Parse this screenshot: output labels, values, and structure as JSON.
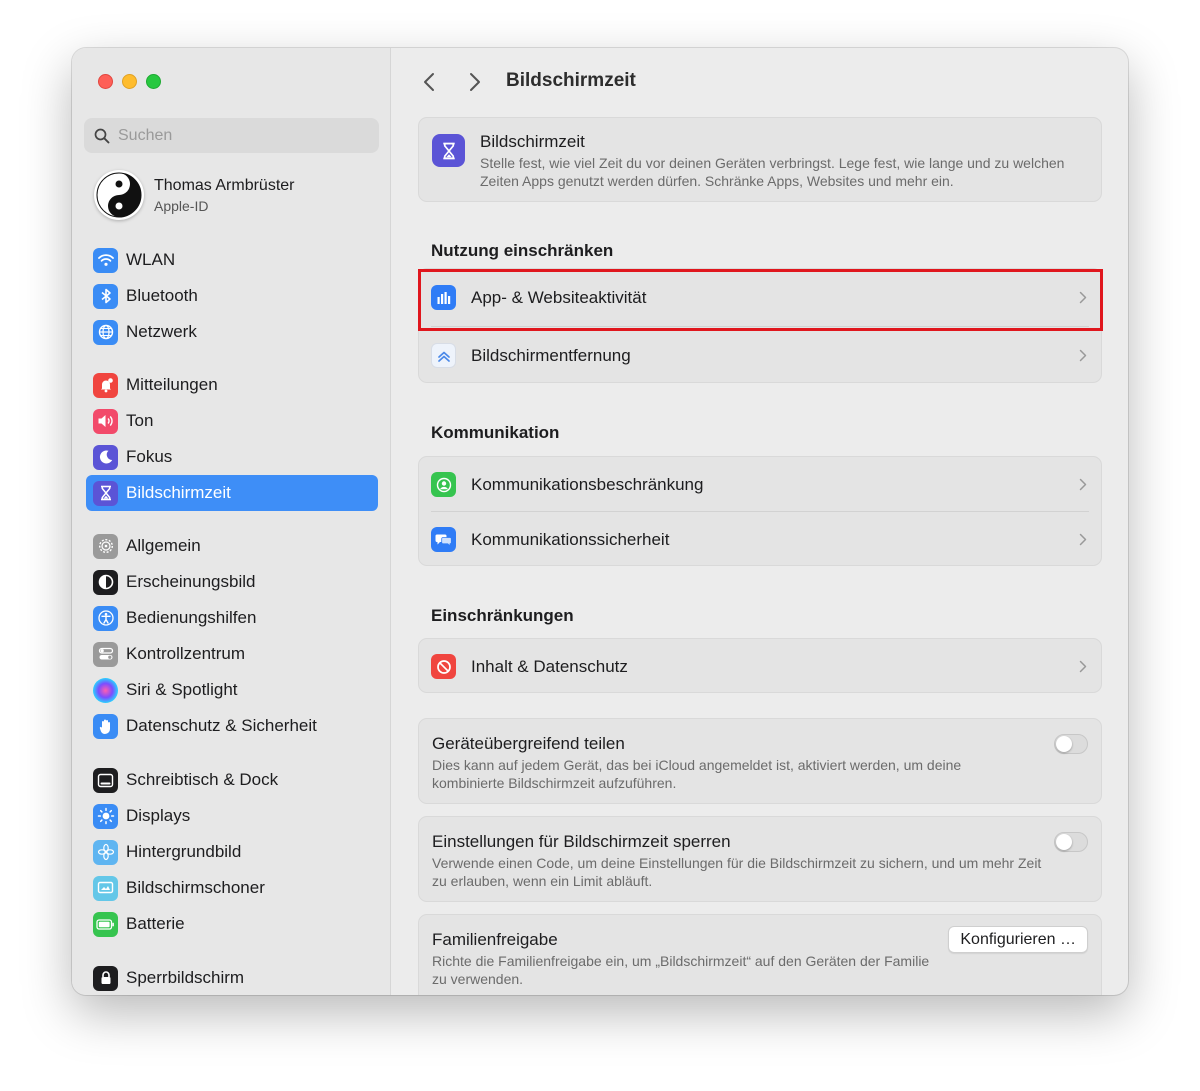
{
  "window": {
    "title": "Bildschirmzeit"
  },
  "sidebar": {
    "search_placeholder": "Suchen",
    "profile": {
      "name": "Thomas Armbrüster",
      "subtitle": "Apple-ID"
    },
    "items": [
      {
        "label": "WLAN",
        "icon": "wifi-icon",
        "color": "#3a8cf5"
      },
      {
        "label": "Bluetooth",
        "icon": "bluetooth-icon",
        "color": "#3a8cf5"
      },
      {
        "label": "Netzwerk",
        "icon": "globe-icon",
        "color": "#3a8cf5"
      },
      {
        "label": "Mitteilungen",
        "icon": "bell-icon",
        "color": "#f0453f"
      },
      {
        "label": "Ton",
        "icon": "speaker-icon",
        "color": "#f24a6a"
      },
      {
        "label": "Fokus",
        "icon": "moon-icon",
        "color": "#5b54d6"
      },
      {
        "label": "Bildschirmzeit",
        "icon": "hourglass-icon",
        "color": "#5b54d6",
        "active": true
      },
      {
        "label": "Allgemein",
        "icon": "gear-icon",
        "color": "#9a9a9a"
      },
      {
        "label": "Erscheinungsbild",
        "icon": "appearance-icon",
        "color": "#1d1d1f"
      },
      {
        "label": "Bedienungshilfen",
        "icon": "accessibility-icon",
        "color": "#3a8cf5"
      },
      {
        "label": "Kontrollzentrum",
        "icon": "toggles-icon",
        "color": "#9a9a9a"
      },
      {
        "label": "Siri & Spotlight",
        "icon": "siri-icon",
        "color": "#2b2b3a"
      },
      {
        "label": "Datenschutz & Sicherheit",
        "icon": "hand-icon",
        "color": "#3a8cf5"
      },
      {
        "label": "Schreibtisch & Dock",
        "icon": "dock-icon",
        "color": "#1d1d1f"
      },
      {
        "label": "Displays",
        "icon": "sun-icon",
        "color": "#3a8cf5"
      },
      {
        "label": "Hintergrundbild",
        "icon": "flower-icon",
        "color": "#5fb5f1"
      },
      {
        "label": "Bildschirmschoner",
        "icon": "screensaver-icon",
        "color": "#64c7e8"
      },
      {
        "label": "Batterie",
        "icon": "battery-icon",
        "color": "#36c44f"
      },
      {
        "label": "Sperrbildschirm",
        "icon": "lock-icon",
        "color": "#1d1d1f"
      }
    ]
  },
  "main": {
    "header": {
      "title": "Bildschirmzeit",
      "description": "Stelle fest, wie viel Zeit du vor deinen Geräten verbringst. Lege fest, wie lange und zu welchen Zeiten Apps genutzt werden dürfen. Schränke Apps, Websites und mehr ein."
    },
    "sections": {
      "nutzung": {
        "title": "Nutzung einschränken",
        "rows": [
          "App- & Websiteaktivität",
          "Bildschirmentfernung"
        ]
      },
      "kommunikation": {
        "title": "Kommunikation",
        "rows": [
          "Kommunikationsbeschränkung",
          "Kommunikationssicherheit"
        ]
      },
      "einschraenkungen": {
        "title": "Einschränkungen",
        "rows": [
          "Inhalt & Datenschutz"
        ]
      }
    },
    "settings": {
      "share": {
        "title": "Geräteübergreifend teilen",
        "description": "Dies kann auf jedem Gerät, das bei iCloud angemeldet ist, aktiviert werden, um deine kombinierte Bildschirmzeit aufzuführen.",
        "enabled": false
      },
      "lock": {
        "title": "Einstellungen für Bildschirmzeit sperren",
        "description": "Verwende einen Code, um deine Einstellungen für die Bildschirmzeit zu sichern, und um mehr Zeit zu erlauben, wenn ein Limit abläuft.",
        "enabled": false
      },
      "family": {
        "title": "Familienfreigabe",
        "description": "Richte die Familienfreigabe ein, um „Bildschirmzeit“ auf den Geräten der Familie zu verwenden.",
        "button_label": "Konfigurieren …"
      }
    }
  },
  "colors": {
    "accent": "#3e8ef7",
    "highlight_border": "#e0161d"
  }
}
